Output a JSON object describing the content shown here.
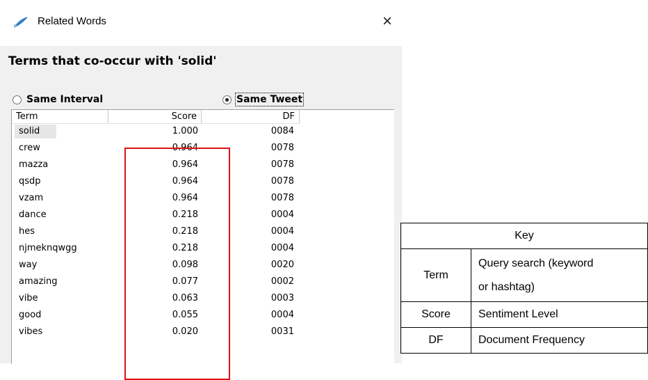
{
  "window": {
    "title": "Related Words",
    "close_glyph": "×",
    "icon": "feather-icon"
  },
  "heading": "Terms that co-occur with 'solid'",
  "radios": [
    {
      "label": "Same Interval",
      "selected": false
    },
    {
      "label": "Same Tweet",
      "selected": true
    }
  ],
  "columns": [
    "Term",
    "Score",
    "DF"
  ],
  "rows": [
    {
      "term": "solid",
      "score": "1.000",
      "df": "0084"
    },
    {
      "term": "crew",
      "score": "0.964",
      "df": "0078"
    },
    {
      "term": "mazza",
      "score": "0.964",
      "df": "0078"
    },
    {
      "term": "qsdp",
      "score": "0.964",
      "df": "0078"
    },
    {
      "term": "vzam",
      "score": "0.964",
      "df": "0078"
    },
    {
      "term": "dance",
      "score": "0.218",
      "df": "0004"
    },
    {
      "term": "hes",
      "score": "0.218",
      "df": "0004"
    },
    {
      "term": "njmeknqwgg",
      "score": "0.218",
      "df": "0004"
    },
    {
      "term": "way",
      "score": "0.098",
      "df": "0020"
    },
    {
      "term": "amazing",
      "score": "0.077",
      "df": "0002"
    },
    {
      "term": "vibe",
      "score": "0.063",
      "df": "0003"
    },
    {
      "term": "good",
      "score": "0.055",
      "df": "0004"
    },
    {
      "term": "vibes",
      "score": "0.020",
      "df": "0031"
    }
  ],
  "key": {
    "title": "Key",
    "entries": [
      {
        "term": "Term",
        "meaning_line1": "Query search (keyword",
        "meaning_line2": "or hashtag)"
      },
      {
        "term": "Score",
        "meaning_line1": "Sentiment Level"
      },
      {
        "term": "DF",
        "meaning_line1": "Document Frequency"
      }
    ]
  },
  "colors": {
    "highlight_border": "#e01010",
    "dialog_bg": "#f0f0f0"
  }
}
